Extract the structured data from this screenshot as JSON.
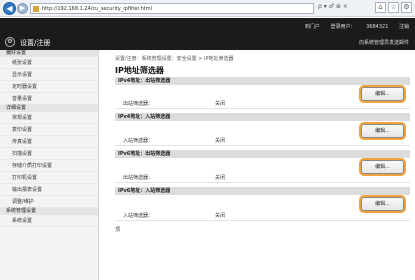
{
  "browser": {
    "address": "http://192.168.1.24/cu_security_ipfilter.html",
    "search_tools": "ρ ▾ ♂ ⊕ ×",
    "back_symbol": "◀",
    "forward_symbol": "▶"
  },
  "header": {
    "logout": "注销",
    "product": "3684321",
    "login_user": "登录用户：",
    "top_page": "到门户",
    "settings_title": "设置/注册",
    "mail_link": "向系统管理员发送邮件"
  },
  "sidebar": {
    "sections": [
      {
        "title": "偏好设置",
        "items": [
          "纸张设置",
          "显示设置",
          "定时器设置",
          "音量设置"
        ]
      },
      {
        "title": "详细设置",
        "items": [
          "常规设置",
          "复印设置",
          "传真设置",
          "扫描设置",
          "存储介质打印设置",
          "打印机设置",
          "输出报表设置",
          "调整/维护"
        ]
      },
      {
        "title": "系统管理设置",
        "items": [
          "系统设置"
        ]
      }
    ]
  },
  "main": {
    "breadcrumb": "设置/注册：系统管理设置：安全设置 > IP地址筛选器",
    "title": "IP地址筛选器",
    "sections": [
      {
        "header": "IPv4地址：出站筛选器",
        "label": "出站筛选器：",
        "value": "关闭",
        "button": "编辑..."
      },
      {
        "header": "IPv4地址：入站筛选器",
        "label": "入站筛选器：",
        "value": "关闭",
        "button": "编辑..."
      },
      {
        "header": "IPv6地址：出站筛选器",
        "label": "出站筛选器：",
        "value": "关闭",
        "button": "编辑..."
      },
      {
        "header": "IPv6地址：入站筛选器",
        "label": "入站筛选器：",
        "value": "关闭",
        "button": "编辑..."
      }
    ],
    "top_link": "顶"
  },
  "colors": {
    "accent_outline": "#f2a23b",
    "header_bg": "#1b1b1b",
    "section_bg": "#dcdcdc"
  }
}
